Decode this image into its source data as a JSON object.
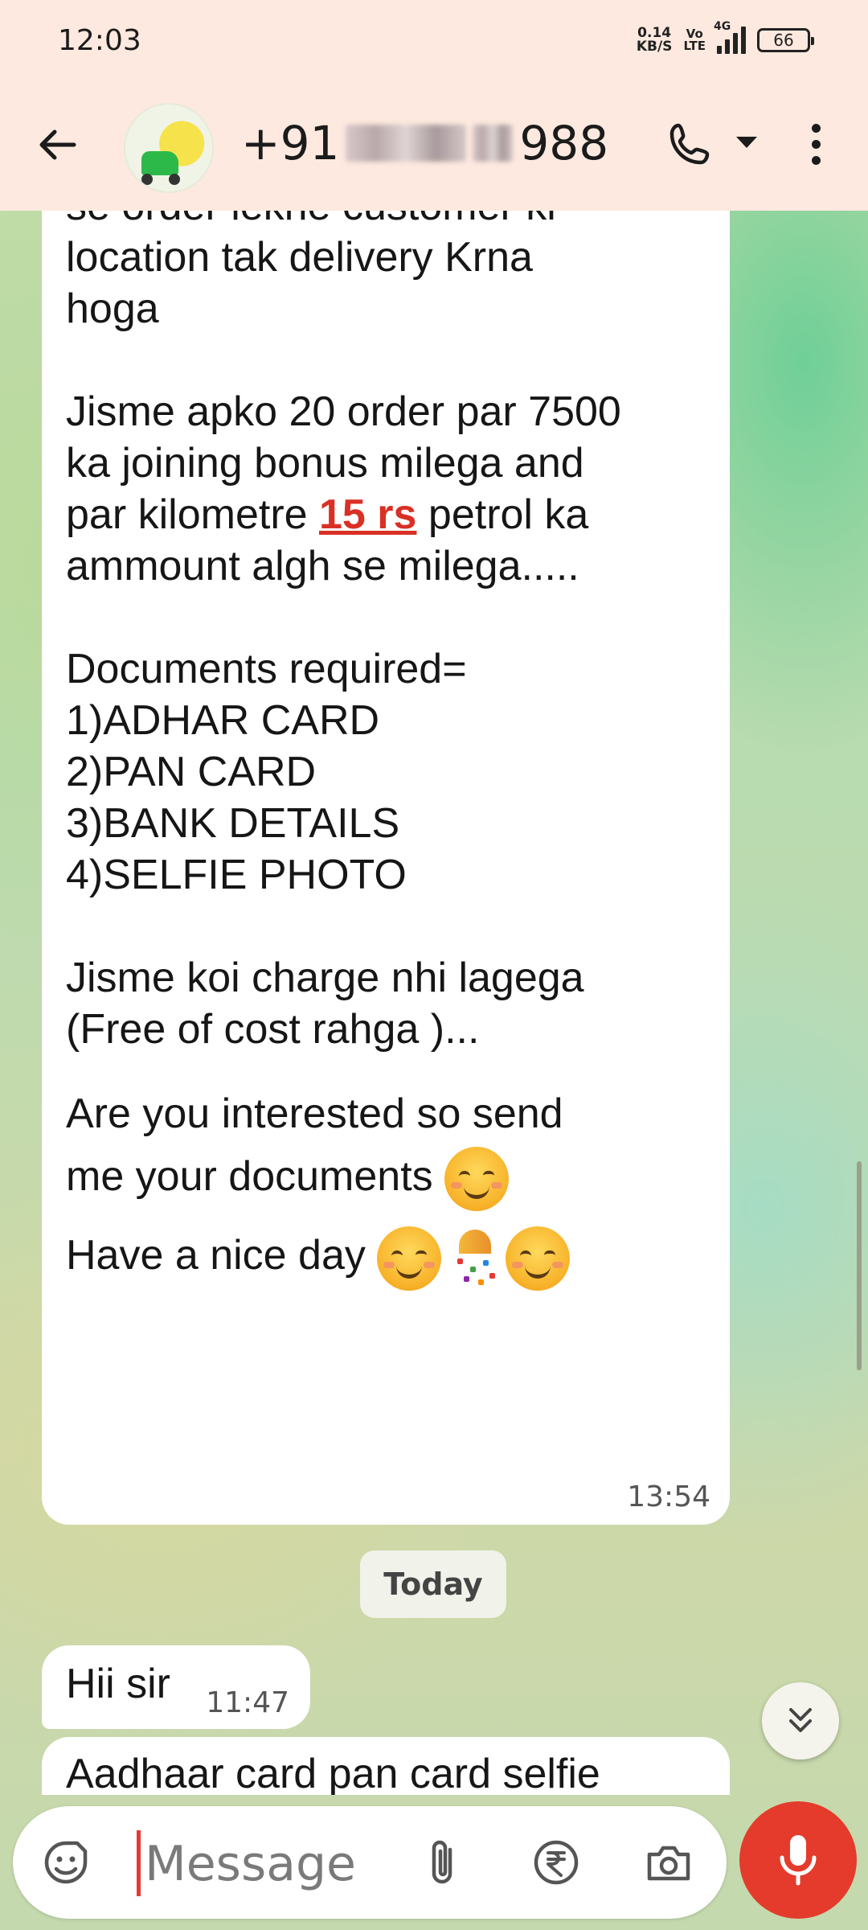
{
  "status": {
    "time": "12:03",
    "net_speed_top": "0.14",
    "net_speed_bottom": "KB/S",
    "volte_top": "Vo",
    "volte_bottom": "LTE",
    "network": "4G",
    "battery": "66"
  },
  "header": {
    "contact_prefix": "+91",
    "contact_suffix": "988"
  },
  "messages": {
    "big": {
      "line_partial": "se order lekhe customer ki",
      "p1": "location tak delivery Krna\nhoga",
      "p2_a": "Jisme apko 20 order par 7500\nka joining bonus milega and\npar kilometre ",
      "p2_highlight": "15 rs",
      "p2_b": " petrol ka\nammount algh se milega.....",
      "p3": "Documents required=\n1)ADHAR CARD\n2)PAN CARD\n3)BANK DETAILS\n4)SELFIE PHOTO",
      "p4": "Jisme koi charge nhi lagega\n(Free of cost rahga )...",
      "p5": "Are you interested so send\nme your documents",
      "p6": "Have a nice day",
      "time": "13:54"
    },
    "date_chip": "Today",
    "small": {
      "text": "Hii sir",
      "time": "11:47"
    },
    "cut": {
      "text": "Aadhaar card pan card selfie"
    }
  },
  "composer": {
    "placeholder": "Message"
  }
}
